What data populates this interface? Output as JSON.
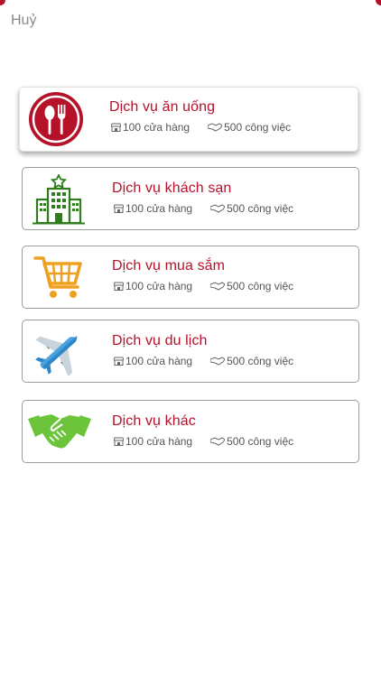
{
  "header": {
    "cancel_label": "Huỷ"
  },
  "colors": {
    "brand_red": "#b5122a",
    "hotel_green": "#2f7d1e",
    "cart_orange": "#f0a020",
    "plane_blue": "#4aa3df",
    "handshake_green": "#6cc43a"
  },
  "services": [
    {
      "title": "Dịch vụ ăn uống",
      "stores": "100 cửa hàng",
      "jobs": "500 công việc",
      "icon": "restaurant-icon"
    },
    {
      "title": "Dịch vụ khách sạn",
      "stores": "100 cửa hàng",
      "jobs": "500 công việc",
      "icon": "hotel-icon"
    },
    {
      "title": "Dịch vụ mua sắm",
      "stores": "100 cửa hàng",
      "jobs": "500 công việc",
      "icon": "shopping-cart-icon"
    },
    {
      "title": "Dịch vụ du lịch",
      "stores": "100 cửa hàng",
      "jobs": "500 công việc",
      "icon": "airplane-icon"
    },
    {
      "title": "Dịch vụ khác",
      "stores": "100 cửa hàng",
      "jobs": "500 công việc",
      "icon": "handshake-icon"
    }
  ]
}
